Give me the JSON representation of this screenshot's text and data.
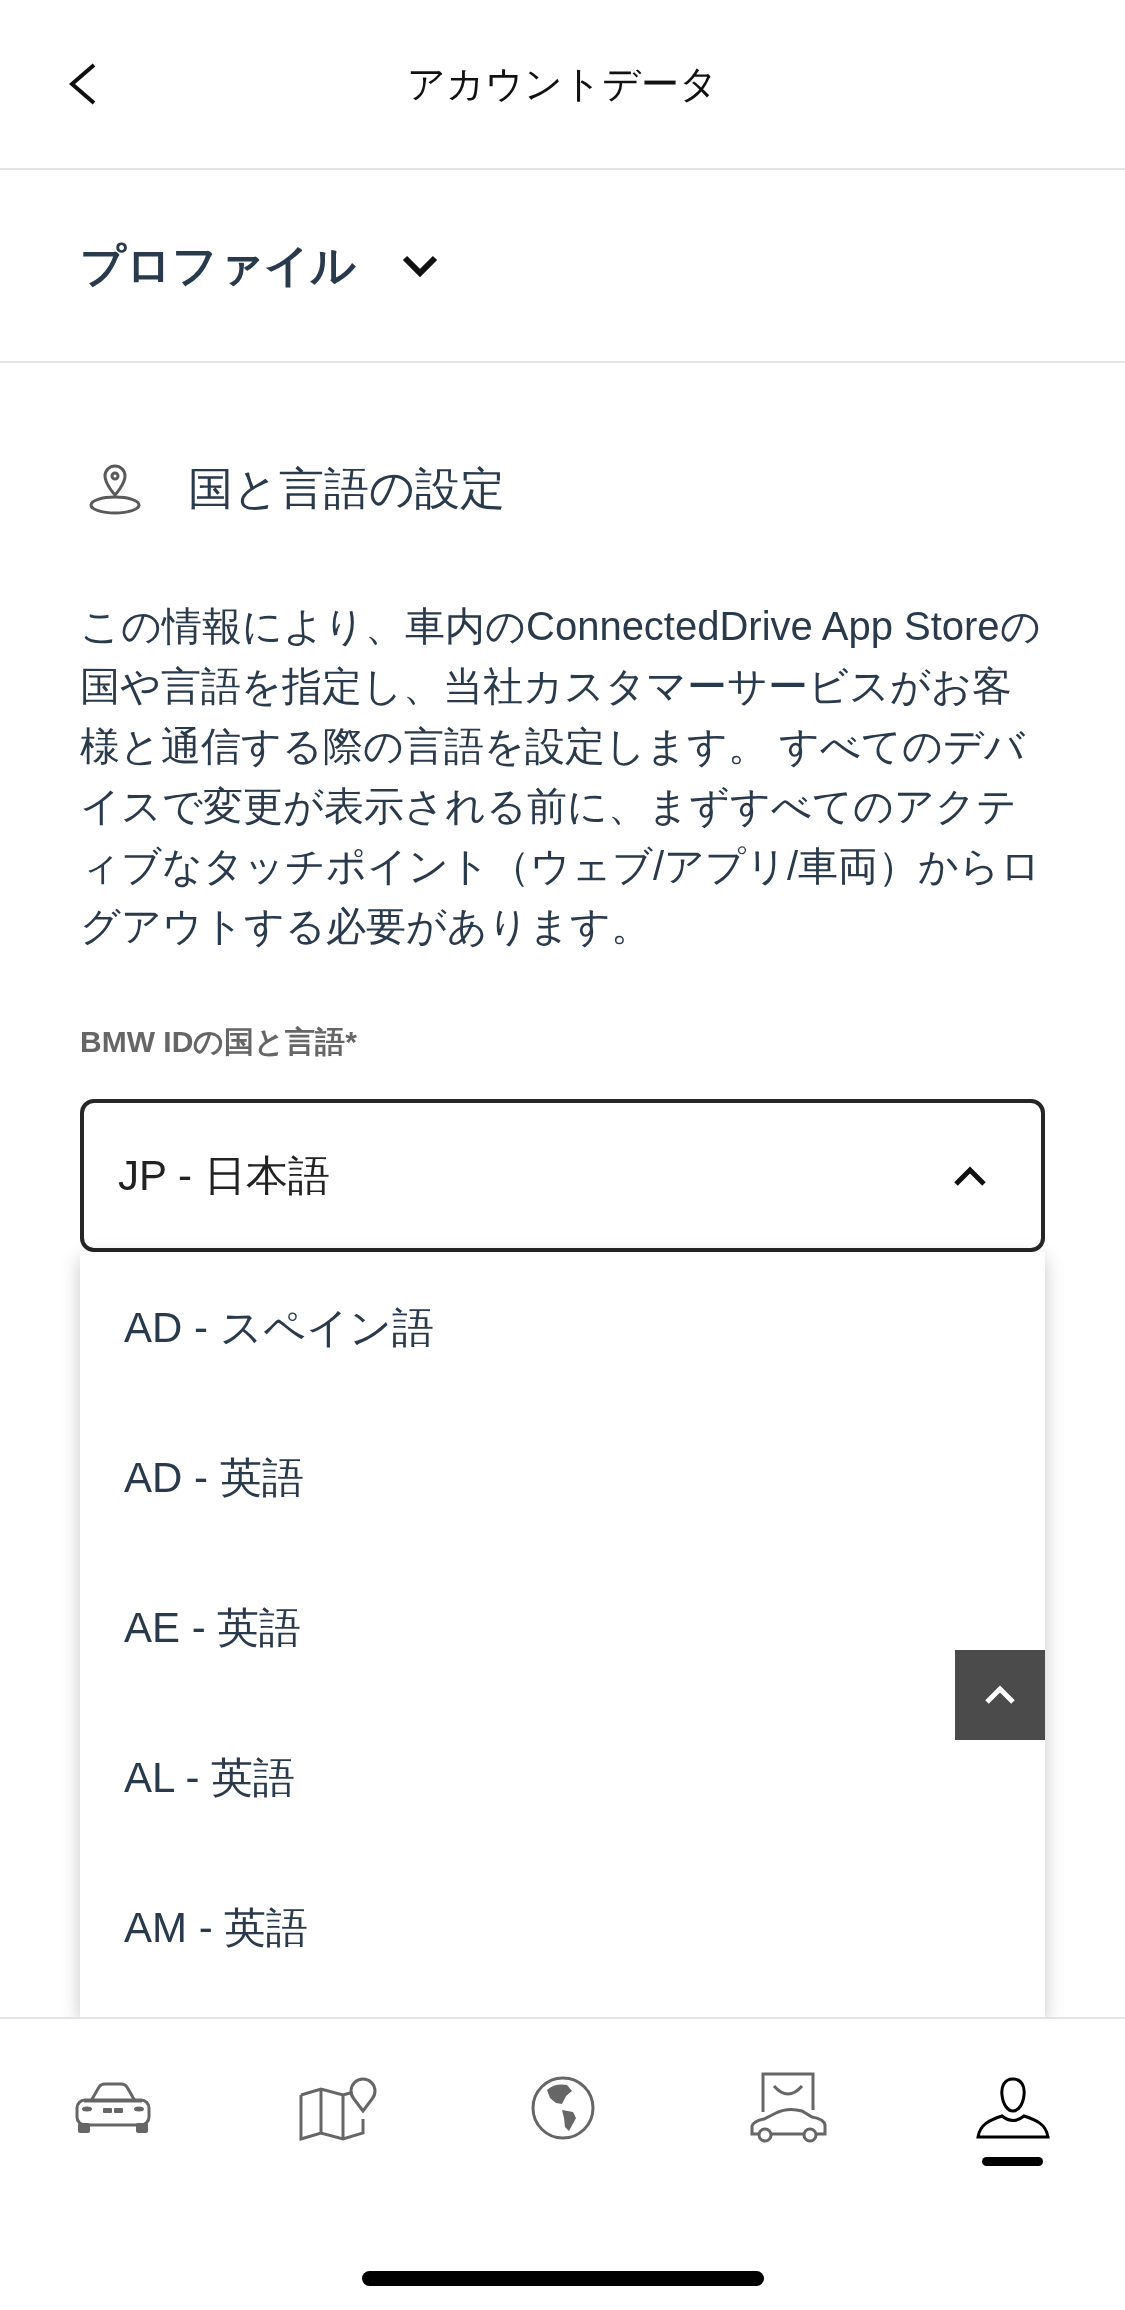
{
  "header": {
    "title": "アカウントデータ"
  },
  "profile_selector": {
    "title": "プロファイル"
  },
  "country_language": {
    "heading": "国と言語の設定",
    "description": "この情報により、車内のConnectedDrive App Storeの国や言語を指定し、当社カスタマーサービスがお客様と通信する際の言語を設定します。 すべてのデバイスで変更が表示される前に、まずすべてのアクティブなタッチポイント（ウェブ/アプリ/車両）からログアウトする必要があります。",
    "field_label": "BMW IDの国と言語*",
    "value": "JP - 日本語",
    "expanded": true,
    "options": [
      {
        "label": "AD - スペイン語",
        "selected": false
      },
      {
        "label": "AD - 英語",
        "selected": false
      },
      {
        "label": "AE - 英語",
        "selected": false
      },
      {
        "label": "AL - 英語",
        "selected": false
      },
      {
        "label": "AM - 英語",
        "selected": false
      }
    ]
  },
  "bottom_nav": [
    {
      "kind": "car",
      "selected": false
    },
    {
      "kind": "map",
      "selected": false
    },
    {
      "kind": "globe",
      "selected": false
    },
    {
      "kind": "shop",
      "selected": false
    },
    {
      "kind": "profile",
      "selected": true
    }
  ]
}
